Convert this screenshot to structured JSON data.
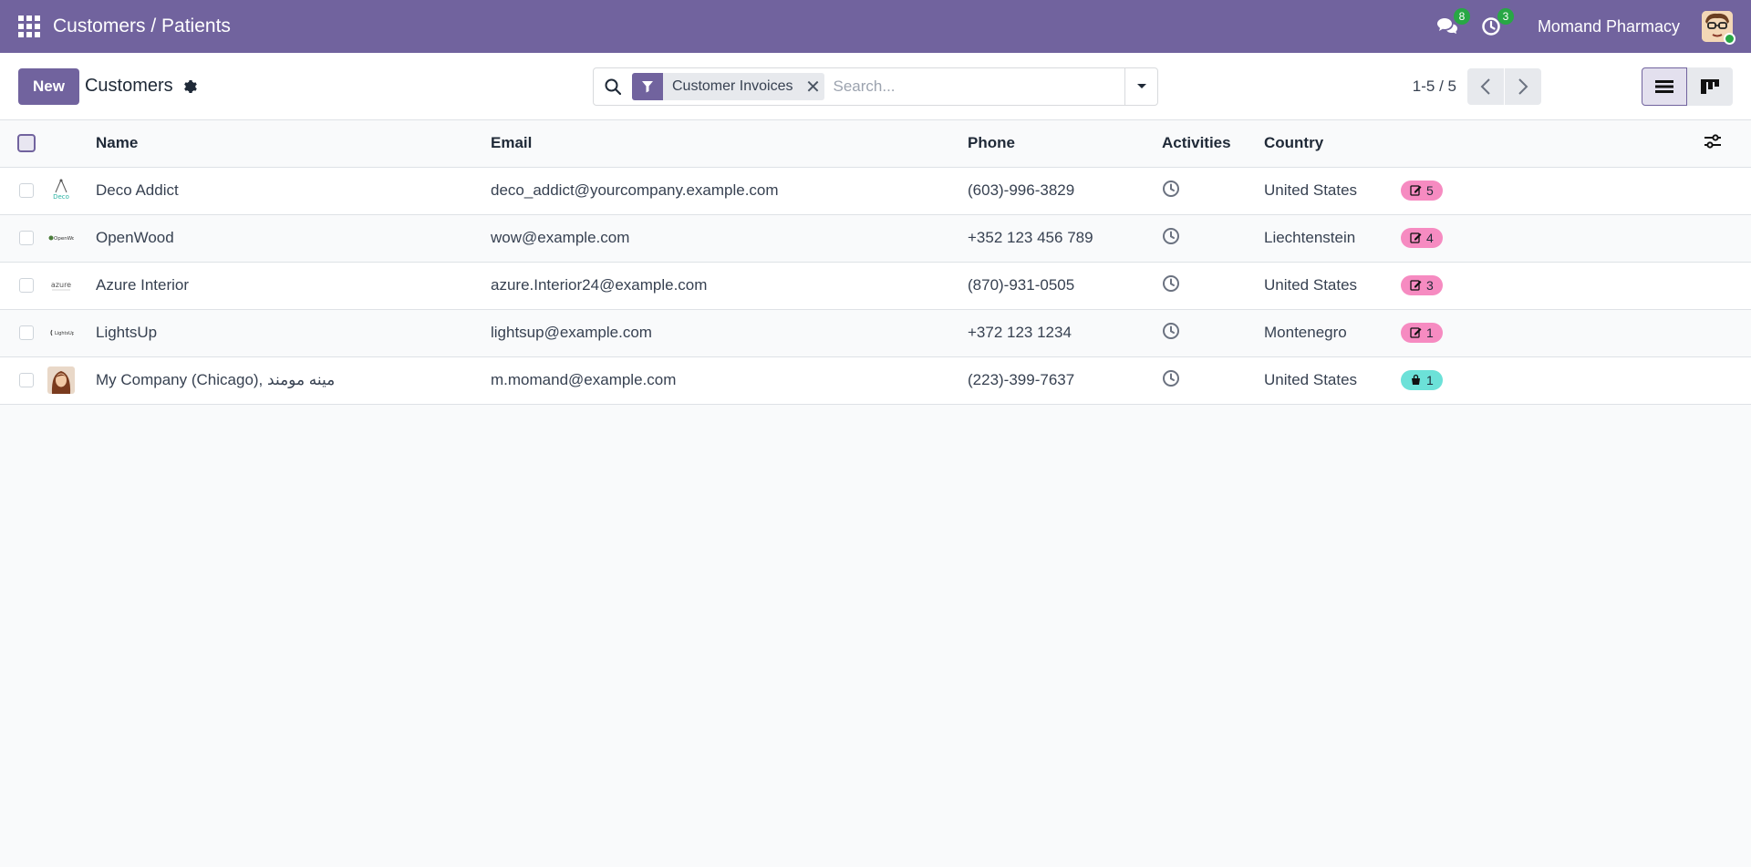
{
  "navbar": {
    "breadcrumb": "Customers / Patients",
    "messages_count": "8",
    "activities_count": "3",
    "company": "Momand Pharmacy"
  },
  "control": {
    "new_label": "New",
    "title": "Customers",
    "facet_label": "Customer Invoices",
    "search_placeholder": "Search...",
    "pager": "1-5 / 5"
  },
  "table": {
    "headers": {
      "name": "Name",
      "email": "Email",
      "phone": "Phone",
      "activities": "Activities",
      "country": "Country"
    },
    "rows": [
      {
        "name": "Deco Addict",
        "email": "deco_addict@yourcompany.example.com",
        "phone": "(603)-996-3829",
        "country": "United States",
        "tag_count": "5",
        "tag_icon": "edit-icon",
        "tag_color": "#f68bc1",
        "logo": "Deco"
      },
      {
        "name": "OpenWood",
        "email": "wow@example.com",
        "phone": "+352 123 456 789",
        "country": "Liechtenstein",
        "tag_count": "4",
        "tag_icon": "edit-icon",
        "tag_color": "#f68bc1",
        "logo": "OpenWood"
      },
      {
        "name": "Azure Interior",
        "email": "azure.Interior24@example.com",
        "phone": "(870)-931-0505",
        "country": "United States",
        "tag_count": "3",
        "tag_icon": "edit-icon",
        "tag_color": "#f68bc1",
        "logo": "azure"
      },
      {
        "name": "LightsUp",
        "email": "lightsup@example.com",
        "phone": "+372 123 1234",
        "country": "Montenegro",
        "tag_count": "1",
        "tag_icon": "edit-icon",
        "tag_color": "#f68bc1",
        "logo": "LightsUp"
      },
      {
        "name": "My Company (Chicago), مینه مومند",
        "email": "m.momand@example.com",
        "phone": "(223)-399-7637",
        "country": "United States",
        "tag_count": "1",
        "tag_icon": "shopping-bag-icon",
        "tag_color": "#6ce1d8",
        "logo": "photo"
      }
    ]
  },
  "colors": {
    "brand": "#71639e",
    "badge": "#28a745",
    "tag_pink": "#f68bc1",
    "tag_teal": "#6ce1d8"
  }
}
